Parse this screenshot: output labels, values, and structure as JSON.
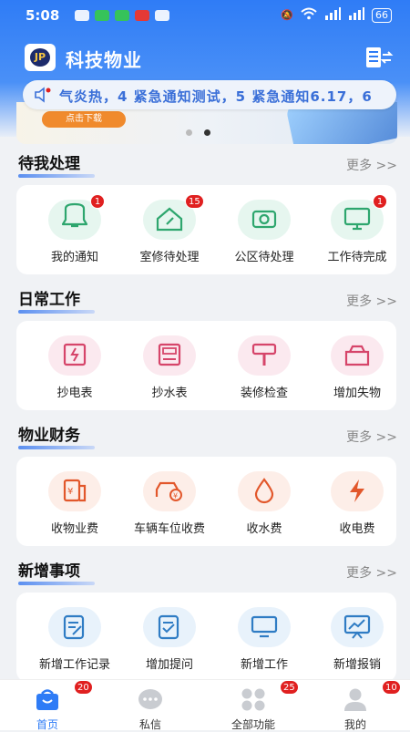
{
  "status": {
    "time": "5:08",
    "battery": "66"
  },
  "app": {
    "title": "科技物业",
    "logo_text": "JP"
  },
  "notice": {
    "text": "气炎热，4 紧急通知测试，5 紧急通知6.17，6"
  },
  "banner": {
    "button": "点击下载"
  },
  "sections": [
    {
      "title": "待我处理",
      "more": "更多 >>",
      "items": [
        {
          "label": "我的通知",
          "icon": "bell-icon",
          "badge": "1",
          "bg": "#e6f6ef",
          "color": "#2ea66e"
        },
        {
          "label": "室修待处理",
          "icon": "house-wrench-icon",
          "badge": "15",
          "bg": "#e6f6ef",
          "color": "#2ea66e"
        },
        {
          "label": "公区待处理",
          "icon": "camera-icon",
          "badge": "",
          "bg": "#e6f6ef",
          "color": "#2ea66e"
        },
        {
          "label": "工作待完成",
          "icon": "monitor-icon",
          "badge": "1",
          "bg": "#e6f6ef",
          "color": "#2ea66e"
        }
      ]
    },
    {
      "title": "日常工作",
      "more": "更多 >>",
      "items": [
        {
          "label": "抄电表",
          "icon": "electric-meter-icon",
          "badge": "",
          "bg": "#fbe9ef",
          "color": "#d6456a"
        },
        {
          "label": "抄水表",
          "icon": "water-meter-icon",
          "badge": "",
          "bg": "#fbe9ef",
          "color": "#d6456a"
        },
        {
          "label": "装修检查",
          "icon": "paint-brush-icon",
          "badge": "",
          "bg": "#fbe9ef",
          "color": "#d6456a"
        },
        {
          "label": "增加失物",
          "icon": "lost-item-box-icon",
          "badge": "",
          "bg": "#fbe9ef",
          "color": "#d6456a"
        }
      ]
    },
    {
      "title": "物业财务",
      "more": "更多 >>",
      "items": [
        {
          "label": "收物业费",
          "icon": "property-fee-icon",
          "badge": "",
          "bg": "#fdeee8",
          "color": "#e2572b"
        },
        {
          "label": "车辆车位收费",
          "icon": "car-fee-icon",
          "badge": "",
          "bg": "#fdeee8",
          "color": "#e2572b"
        },
        {
          "label": "收水费",
          "icon": "water-drop-icon",
          "badge": "",
          "bg": "#fdeee8",
          "color": "#e2572b"
        },
        {
          "label": "收电费",
          "icon": "lightning-icon",
          "badge": "",
          "bg": "#fdeee8",
          "color": "#e2572b"
        }
      ]
    },
    {
      "title": "新增事项",
      "more": "更多 >>",
      "items": [
        {
          "label": "新增工作记录",
          "icon": "edit-note-icon",
          "badge": "",
          "bg": "#e8f2fb",
          "color": "#2f7cc4"
        },
        {
          "label": "增加提问",
          "icon": "question-doc-icon",
          "badge": "",
          "bg": "#e8f2fb",
          "color": "#2f7cc4"
        },
        {
          "label": "新增工作",
          "icon": "monitor-add-icon",
          "badge": "",
          "bg": "#e8f2fb",
          "color": "#2f7cc4"
        },
        {
          "label": "新增报销",
          "icon": "chart-board-icon",
          "badge": "",
          "bg": "#e8f2fb",
          "color": "#2f7cc4"
        }
      ]
    }
  ],
  "tabs": [
    {
      "label": "首页",
      "icon": "home-bag-icon",
      "badge": "20",
      "active": true
    },
    {
      "label": "私信",
      "icon": "chat-bubble-icon",
      "badge": "",
      "active": false
    },
    {
      "label": "全部功能",
      "icon": "grid-apps-icon",
      "badge": "25",
      "active": false
    },
    {
      "label": "我的",
      "icon": "user-icon",
      "badge": "10",
      "active": false
    }
  ],
  "colors": {
    "accent": "#2f7cf6",
    "badge": "#e02020"
  }
}
